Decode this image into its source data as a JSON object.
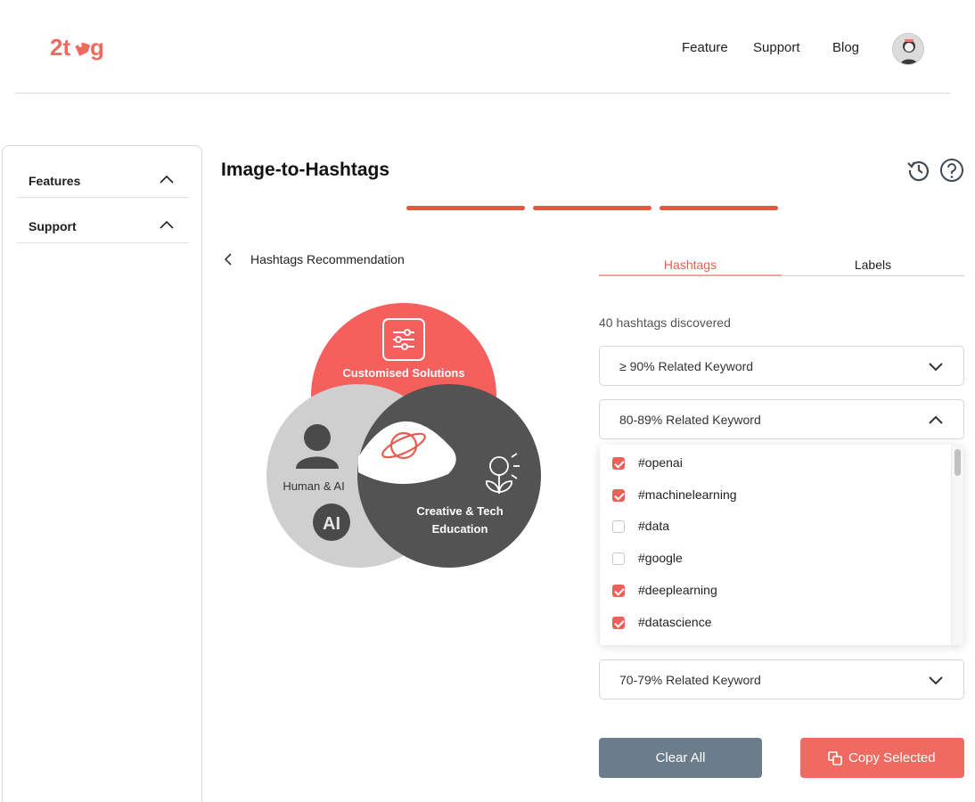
{
  "brand": {
    "logo_text": "2tag",
    "accent": "#EF6B62"
  },
  "nav": {
    "items": [
      "Feature",
      "Support",
      "Blog"
    ]
  },
  "sidebar": {
    "items": [
      {
        "label": "Features",
        "icon": "chevron-up-icon"
      },
      {
        "label": "Support",
        "icon": "chevron-up-icon"
      }
    ]
  },
  "main": {
    "title": "Image-to-Hashtags",
    "subtitle": "Hashtags Recommendation",
    "steps_total": 3,
    "steps_active": 3
  },
  "venn": {
    "top": "Customised Solutions",
    "left": "Human & AI",
    "left_badge": "AI",
    "right_line1": "Creative & Tech",
    "right_line2": "Education"
  },
  "panel": {
    "tabs": [
      "Hashtags",
      "Labels"
    ],
    "active_tab": "Hashtags",
    "count_text": "40 hashtags discovered",
    "groups": [
      {
        "label": "≥ 90% Related Keyword",
        "expanded": false
      },
      {
        "label": "80-89% Related Keyword",
        "expanded": true
      },
      {
        "label": "70-79% Related Keyword",
        "expanded": false
      }
    ],
    "hashtags": [
      {
        "tag": "#openai",
        "checked": true
      },
      {
        "tag": "#machinelearning",
        "checked": true
      },
      {
        "tag": "#data",
        "checked": false
      },
      {
        "tag": "#google",
        "checked": false
      },
      {
        "tag": "#deeplearning",
        "checked": true
      },
      {
        "tag": "#datascience",
        "checked": true
      }
    ],
    "clear_label": "Clear All",
    "copy_label": "Copy Selected"
  }
}
